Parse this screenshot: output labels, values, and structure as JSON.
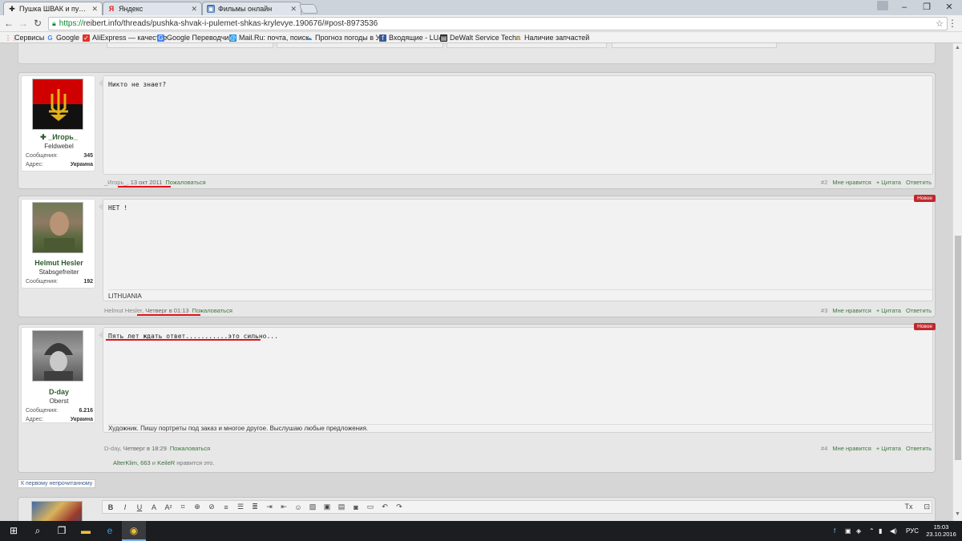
{
  "browser": {
    "tabs": [
      {
        "title": "Пушка ШВАК и пулемет",
        "icon": "cross-icon",
        "active": true
      },
      {
        "title": "Яндекс",
        "icon": "yandex-icon",
        "active": false
      },
      {
        "title": "Фильмы онлайн",
        "icon": "film-icon",
        "active": false
      }
    ],
    "url_protocol": "https://",
    "url_rest": "reibert.info/threads/pushka-shvak-i-pulemet-shkas-krylevye.190676/#post-8973536",
    "bookmarks": [
      {
        "label": "Сервисы",
        "icon": "apps-icon",
        "color": "#c8352b"
      },
      {
        "label": "Google",
        "icon": "google-icon",
        "color": "#4285f4"
      },
      {
        "label": "AliExpress — качестве",
        "icon": "aliexpress-icon",
        "color": "#e43225"
      },
      {
        "label": "Google Переводчик",
        "icon": "translate-icon",
        "color": "#4285f4"
      },
      {
        "label": "Mail.Ru: почта, поиск",
        "icon": "mail-icon",
        "color": "#168de2"
      },
      {
        "label": "Прогноз погоды в Ук",
        "icon": "weather-icon",
        "color": "#3a8fd0"
      },
      {
        "label": "Входящие - LUA",
        "icon": "facebook-icon",
        "color": "#3b5998"
      },
      {
        "label": "DeWalt Service Techn",
        "icon": "dewalt-icon",
        "color": "#222222"
      },
      {
        "label": "Наличие запчастей",
        "icon": "warning-icon",
        "color": "#e8a21a"
      }
    ]
  },
  "posts": [
    {
      "author": "_Игорь_",
      "rank": "Feldwebel",
      "stats": [
        {
          "label": "Сообщения:",
          "value": "345"
        },
        {
          "label": "Адрес:",
          "value": "Украина"
        }
      ],
      "message": "Никто не знает?",
      "signature": "",
      "meta_author": "_Игорь_",
      "meta_date": "13 окт 2011",
      "report": "Пожаловаться",
      "num": "#2",
      "like": "Мне нравится",
      "quote": "+ Цитата",
      "reply": "Ответить",
      "is_new": false
    },
    {
      "author": "Helmut Hesler",
      "rank": "Stabsgefreiter",
      "stats": [
        {
          "label": "Сообщения:",
          "value": "192"
        }
      ],
      "message": "НЕТ !",
      "signature": "LITHUANIA",
      "meta_author": "Helmut Hesler",
      "meta_date": "Четверг в 01:13",
      "report": "Пожаловаться",
      "num": "#3",
      "like": "Мне нравится",
      "quote": "+ Цитата",
      "reply": "Ответить",
      "is_new": true,
      "new_label": "Новое"
    },
    {
      "author": "D-day",
      "rank": "Oberst",
      "stats": [
        {
          "label": "Сообщения:",
          "value": "6.216"
        },
        {
          "label": "Адрес:",
          "value": "Украина"
        }
      ],
      "message": "Пять лет ждать ответ...........это сильно...",
      "signature": "Художник. Пишу портреты под заказ и многое другое. Выслушаю любые предложения.",
      "meta_author": "D-day",
      "meta_date": "Четверг в 18:29",
      "report": "Пожаловаться",
      "num": "#4",
      "like": "Мне нравится",
      "quote": "+ Цитата",
      "reply": "Ответить",
      "is_new": true,
      "new_label": "Новое",
      "likes_users": "AlterKlim, 663",
      "likes_and": "и",
      "likes_user2": "KeileR",
      "likes_suffix": "нравится это."
    }
  ],
  "first_unread": "К первому непрочитанному",
  "taskbar": {
    "lang": "РУС",
    "time": "15:03",
    "date": "23.10.2016"
  }
}
